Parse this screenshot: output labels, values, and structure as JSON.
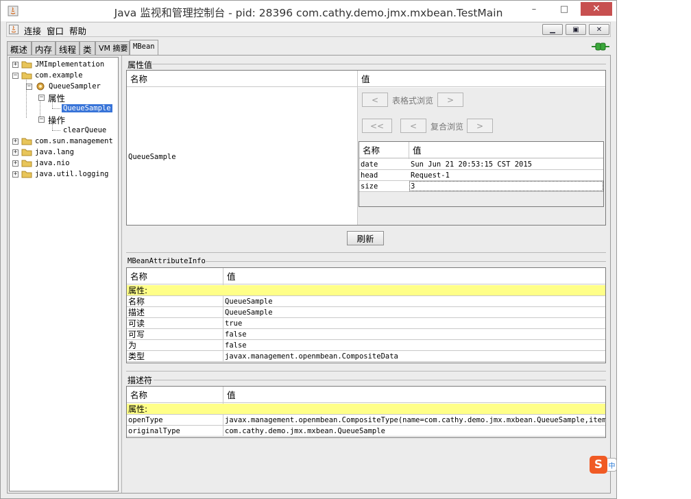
{
  "window": {
    "title": "Java 监视和管理控制台 - pid: 28396 com.cathy.demo.jmx.mxbean.TestMain",
    "minimize": "–",
    "maximize": "□",
    "close": "✕"
  },
  "menubar": {
    "items": [
      "连接",
      "窗口",
      "帮助"
    ],
    "inner_min": "▁",
    "inner_restore": "▣",
    "inner_close": "✕"
  },
  "tabs": [
    "概述",
    "内存",
    "线程",
    "类",
    "VM 摘要",
    "MBean"
  ],
  "active_tab": "MBean",
  "tree": {
    "nodes": [
      {
        "label": "JMImplementation",
        "expander": "+"
      },
      {
        "label": "com.example",
        "expander": "−"
      },
      {
        "label": "QueueSampler",
        "expander": "−"
      },
      {
        "label": "属性",
        "expander": "−"
      },
      {
        "label": "QueueSample"
      },
      {
        "label": "操作",
        "expander": "−"
      },
      {
        "label": "clearQueue"
      },
      {
        "label": "com.sun.management",
        "expander": "+"
      },
      {
        "label": "java.lang",
        "expander": "+"
      },
      {
        "label": "java.nio",
        "expander": "+"
      },
      {
        "label": "java.util.logging",
        "expander": "+"
      }
    ]
  },
  "attr_values": {
    "section_title": "属性值",
    "col_name": "名称",
    "col_value": "值",
    "attribute_name": "QueueSample",
    "tabular": {
      "label": "表格式浏览",
      "prev": "<",
      "next": ">"
    },
    "composite": {
      "label": "复合浏览",
      "first": "<<",
      "prev": "<",
      "next": ">"
    },
    "inner_table": {
      "col_name": "名称",
      "col_value": "值",
      "rows": [
        {
          "name": "date",
          "value": "Sun Jun 21 20:53:15 CST 2015"
        },
        {
          "name": "head",
          "value": "Request-1"
        },
        {
          "name": "size",
          "value": "3"
        }
      ]
    },
    "refresh_button": "刷新"
  },
  "attr_info": {
    "section_title": "MBeanAttributeInfo",
    "col_name": "名称",
    "col_value": "值",
    "rows": [
      {
        "name": "属性:",
        "value": "",
        "highlight": true
      },
      {
        "name": "名称",
        "value": "QueueSample"
      },
      {
        "name": "描述",
        "value": "QueueSample"
      },
      {
        "name": "可读",
        "value": "true"
      },
      {
        "name": "可写",
        "value": "false"
      },
      {
        "name": "为",
        "value": "false"
      },
      {
        "name": "类型",
        "value": "javax.management.openmbean.CompositeData"
      }
    ]
  },
  "descriptor": {
    "section_title": "描述符",
    "col_name": "名称",
    "col_value": "值",
    "rows": [
      {
        "name": "属性:",
        "value": "",
        "highlight": true
      },
      {
        "name": "openType",
        "value": "javax.management.openmbean.CompositeType(name=com.cathy.demo.jmx.mxbean.QueueSample,items..."
      },
      {
        "name": "originalType",
        "value": "com.cathy.demo.jmx.mxbean.QueueSample"
      }
    ]
  },
  "colors": {
    "selection": "#3874d8",
    "highlight_row": "#ffff88",
    "close_button": "#c75050",
    "ime_logo": "#f05a24"
  },
  "ime": {
    "logo": "S",
    "tab": "中"
  }
}
